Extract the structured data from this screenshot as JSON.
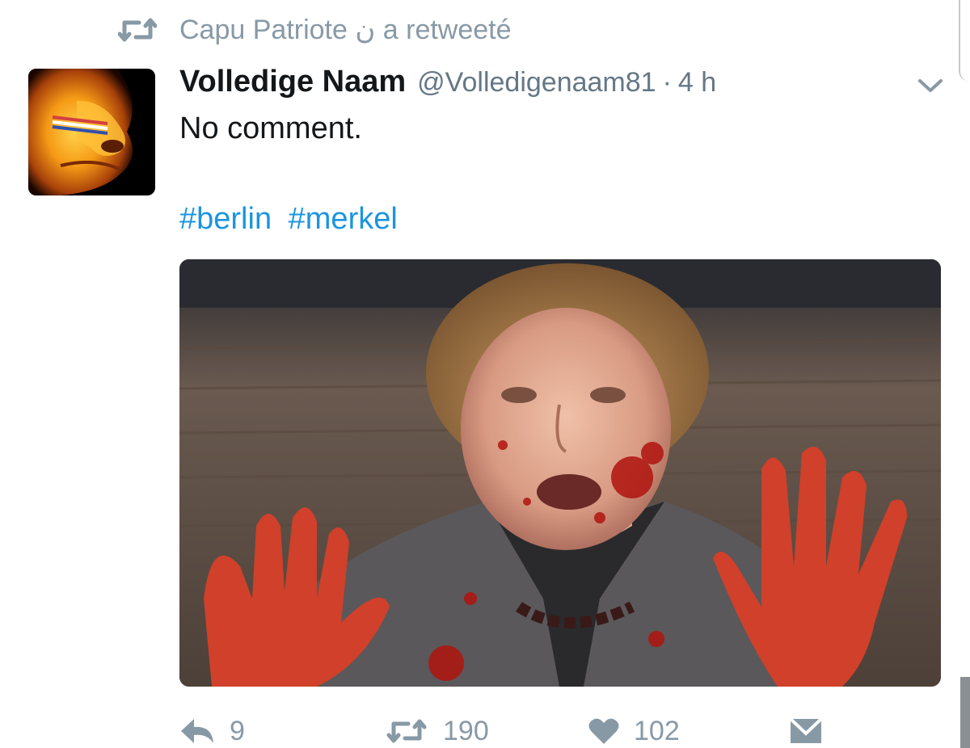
{
  "retweet_context": {
    "icon": "retweet-icon",
    "text": "Capu Patriote ن a retweeté"
  },
  "tweet": {
    "author": {
      "name": "Volledige Naam",
      "handle": "@Volledigenaam81",
      "avatar_icon": "lion-avatar"
    },
    "separator": "·",
    "time": "4 h",
    "text": "No comment.",
    "hashtags": [
      "#berlin",
      "#merkel"
    ],
    "media": {
      "type": "photo"
    },
    "actions": {
      "reply": {
        "icon": "reply-icon",
        "count": "9"
      },
      "retweet": {
        "icon": "retweet-icon",
        "count": "190"
      },
      "like": {
        "icon": "heart-icon",
        "count": "102"
      },
      "message": {
        "icon": "direct-message-icon"
      }
    }
  },
  "colors": {
    "link": "#1b95e0",
    "muted": "#8899a6",
    "text": "#14171a"
  }
}
